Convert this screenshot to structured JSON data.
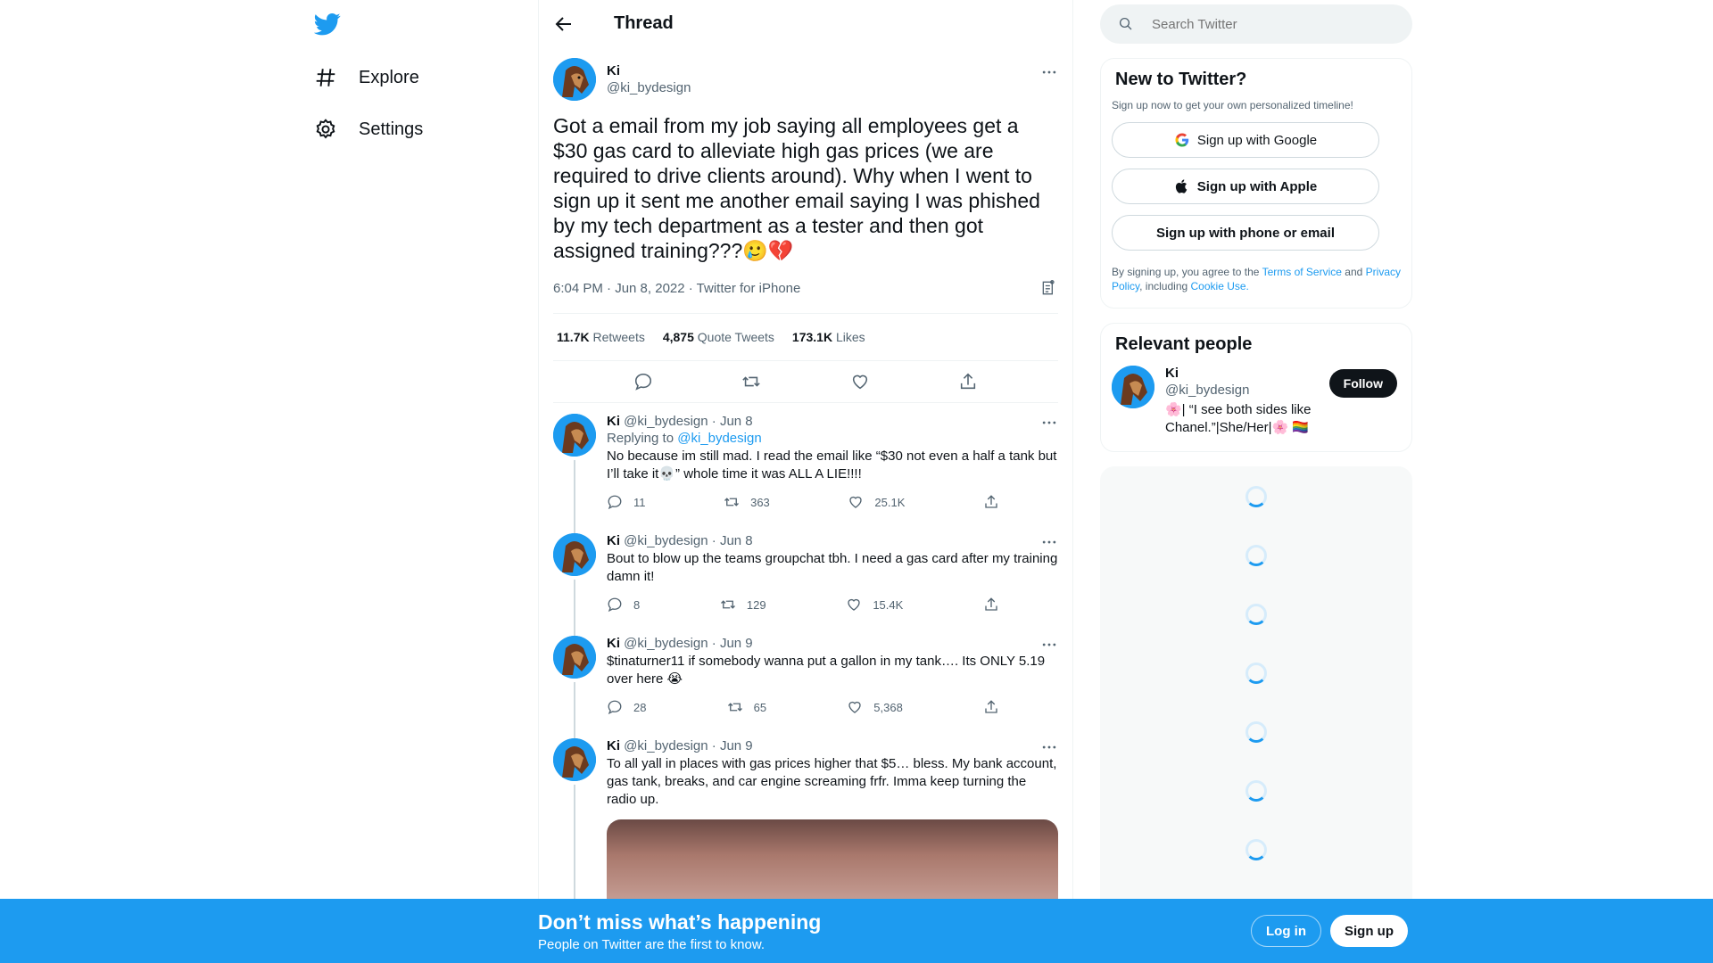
{
  "nav": {
    "items": [
      {
        "label": "Explore"
      },
      {
        "label": "Settings"
      }
    ]
  },
  "thread": {
    "title": "Thread",
    "main_tweet": {
      "name": "Ki",
      "handle": "@ki_bydesign",
      "text": "Got a email from my job saying all employees get a $30 gas card to alleviate high gas prices (we are required to drive clients around). Why when I went to sign up it sent me another email saying I was phished by my tech department as a tester and then got assigned training???🥲💔",
      "meta": "6:04 PM · Jun 8, 2022 · Twitter for iPhone",
      "retweets_count": "11.7K",
      "retweets_label": "Retweets",
      "quotes_count": "4,875",
      "quotes_label": "Quote Tweets",
      "likes_count": "173.1K",
      "likes_label": "Likes"
    },
    "replies": [
      {
        "name": "Ki",
        "handle_date": "@ki_bydesign · Jun 8",
        "replying_prefix": "Replying to",
        "replying_to": "@ki_bydesign",
        "text": "No because im still mad. I read the email like “$30 not even a half a tank but I’ll take it💀”  whole time it was ALL A LIE!!!!",
        "replies": "11",
        "retweets": "363",
        "likes": "25.1K"
      },
      {
        "name": "Ki",
        "handle_date": "@ki_bydesign · Jun 8",
        "text": "Bout to blow up the teams groupchat tbh. I need a gas card after my training damn it!",
        "replies": "8",
        "retweets": "129",
        "likes": "15.4K"
      },
      {
        "name": "Ki",
        "handle_date": "@ki_bydesign · Jun 9",
        "text": "$tinaturner11 if somebody wanna put a gallon in my tank…. Its ONLY 5.19 over here 😭",
        "replies": "28",
        "retweets": "65",
        "likes": "5,368"
      },
      {
        "name": "Ki",
        "handle_date": "@ki_bydesign · Jun 9",
        "text": "To all yall in places with gas prices higher that $5… bless. My bank account, gas tank, breaks, and car engine screaming frfr. Imma keep turning the radio up."
      }
    ]
  },
  "search": {
    "placeholder": "Search Twitter"
  },
  "signup_card": {
    "title": "New to Twitter?",
    "subtitle": "Sign up now to get your own personalized timeline!",
    "google": "Sign up with Google",
    "apple": "Sign up with Apple",
    "phone": "Sign up with phone or email",
    "legal_1": "By signing up, you agree to the",
    "terms": "Terms of Service",
    "legal_2": "and",
    "privacy": "Privacy Policy",
    "legal_3": ", including",
    "cookie": "Cookie Use."
  },
  "relevant": {
    "title": "Relevant people",
    "name": "Ki",
    "handle": "@ki_bydesign",
    "bio": "🌸| “I see both sides like Chanel.”|She/Her|🌸 🏳️‍🌈",
    "follow": "Follow"
  },
  "bottom_bar": {
    "heading": "Don’t miss what’s happening",
    "sub": "People on Twitter are the first to know.",
    "login": "Log in",
    "signup": "Sign up"
  },
  "colors": {
    "accent": "#1d9bf0",
    "text": "#0f1419",
    "muted": "#536471"
  }
}
